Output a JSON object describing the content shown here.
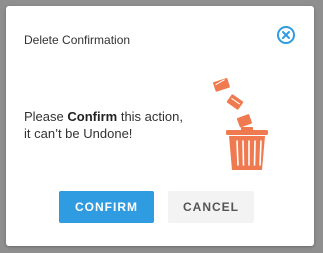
{
  "dialog": {
    "title": "Delete Confirmation",
    "message_prefix": "Please ",
    "message_bold": "Confirm",
    "message_line1_suffix": " this action,",
    "message_line2": "it can’t be Undone!",
    "close_icon": "close-circle-icon",
    "illustration_icon": "trash-can-with-falling-papers-icon",
    "confirm_label": "CONFIRM",
    "cancel_label": "CANCEL"
  },
  "colors": {
    "overlay": "#8f8f8f",
    "accent": "#2f9be0",
    "trash": "#f07a50",
    "cancel_bg": "#f3f3f3",
    "text": "#333333"
  }
}
